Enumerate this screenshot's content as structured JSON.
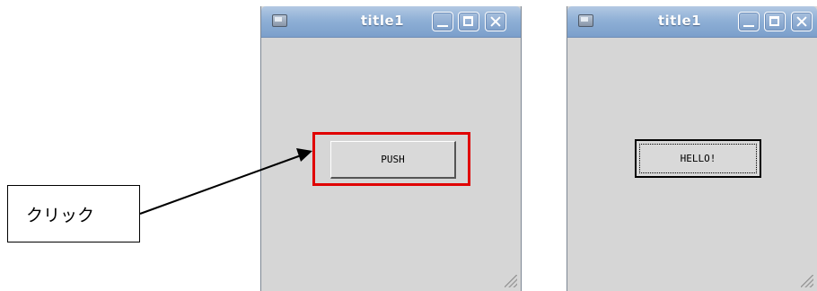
{
  "windows": [
    {
      "title": "title1",
      "button_label": "PUSH"
    },
    {
      "title": "title1",
      "button_label": "HELLO!"
    }
  ],
  "callout": {
    "label": "クリック"
  },
  "colors": {
    "highlight": "#e00000",
    "titlebar": "#8fb0d6",
    "window_bg": "#d6d6d6"
  }
}
